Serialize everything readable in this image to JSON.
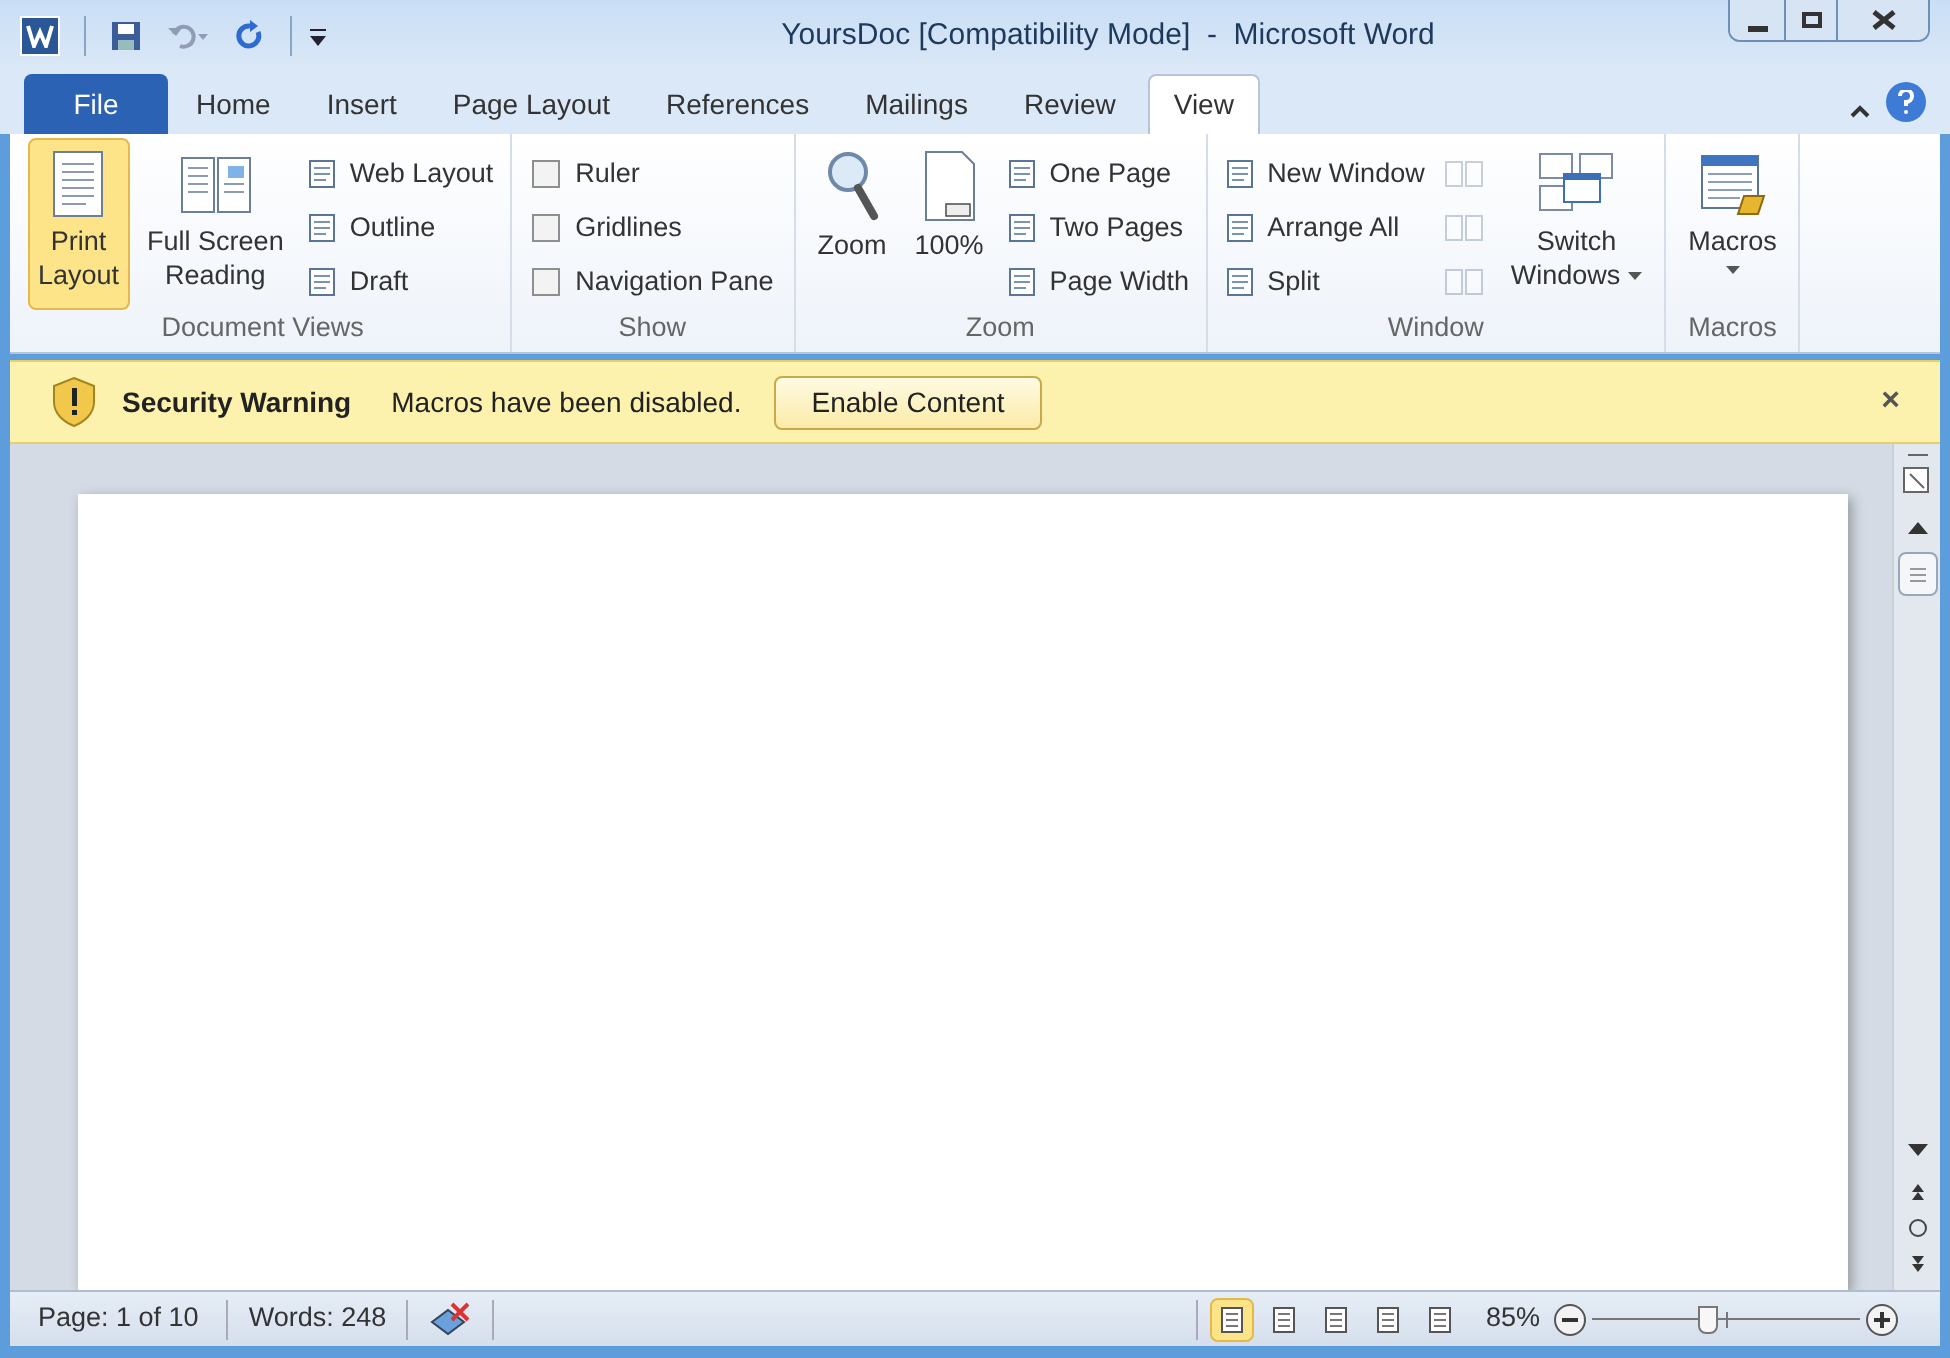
{
  "window": {
    "title": "YoursDoc [Compatibility Mode]  -  Microsoft Word"
  },
  "tabs": [
    {
      "label": "File",
      "kind": "file",
      "selected": false
    },
    {
      "label": "Home",
      "kind": "tab",
      "selected": false
    },
    {
      "label": "Insert",
      "kind": "tab",
      "selected": false
    },
    {
      "label": "Page Layout",
      "kind": "tab",
      "selected": false
    },
    {
      "label": "References",
      "kind": "tab",
      "selected": false
    },
    {
      "label": "Mailings",
      "kind": "tab",
      "selected": false
    },
    {
      "label": "Review",
      "kind": "tab",
      "selected": false
    },
    {
      "label": "View",
      "kind": "tab",
      "selected": true
    }
  ],
  "ribbon": {
    "groups": [
      {
        "title": "Document Views",
        "items": [
          {
            "kind": "large",
            "label": "Print\nLayout",
            "selected": true
          },
          {
            "kind": "large",
            "label": "Full Screen\nReading",
            "selected": false
          },
          {
            "kind": "small",
            "label": "Web Layout"
          },
          {
            "kind": "small",
            "label": "Outline"
          },
          {
            "kind": "small",
            "label": "Draft"
          }
        ]
      },
      {
        "title": "Show",
        "items": [
          {
            "kind": "checkbox",
            "label": "Ruler",
            "checked": false
          },
          {
            "kind": "checkbox",
            "label": "Gridlines",
            "checked": false
          },
          {
            "kind": "checkbox",
            "label": "Navigation Pane",
            "checked": false
          }
        ]
      },
      {
        "title": "Zoom",
        "items": [
          {
            "kind": "large",
            "label": "Zoom",
            "selected": false
          },
          {
            "kind": "large",
            "label": "100%",
            "selected": false
          },
          {
            "kind": "small",
            "label": "One Page"
          },
          {
            "kind": "small",
            "label": "Two Pages"
          },
          {
            "kind": "small",
            "label": "Page Width"
          }
        ]
      },
      {
        "title": "Window",
        "items": [
          {
            "kind": "small",
            "label": "New Window"
          },
          {
            "kind": "small",
            "label": "Arrange All"
          },
          {
            "kind": "small",
            "label": "Split"
          },
          {
            "kind": "icon",
            "disabled": true
          },
          {
            "kind": "icon",
            "disabled": true
          },
          {
            "kind": "icon",
            "disabled": true
          },
          {
            "kind": "large",
            "label": "Switch\nWindows",
            "dropdown": true,
            "caret_below": false,
            "selected": false
          }
        ]
      },
      {
        "title": "Macros",
        "items": [
          {
            "kind": "large",
            "label": "Macros",
            "dropdown": true,
            "caret_below": true,
            "selected": false
          }
        ]
      }
    ]
  },
  "message_bar": {
    "title": "Security Warning",
    "message": "Macros have been disabled.",
    "button": "Enable Content",
    "close": "×"
  },
  "status_bar": {
    "page": "Page: 1 of 10",
    "words": "Words: 248",
    "views": [
      {
        "selected": true
      },
      {
        "selected": false
      },
      {
        "selected": false
      },
      {
        "selected": false
      },
      {
        "selected": false
      }
    ],
    "zoom": "85%",
    "zoom_slider": {
      "level": 0.43
    }
  }
}
